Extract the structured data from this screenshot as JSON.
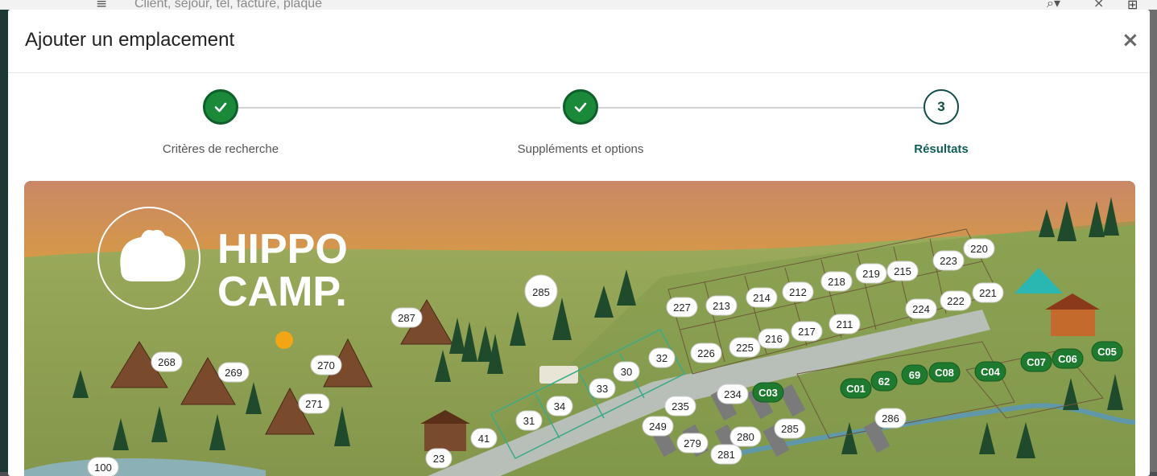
{
  "background": {
    "search_placeholder": "Client, séjour, tél, facture, plaque"
  },
  "modal": {
    "title": "Ajouter un emplacement",
    "close_glyph": "×"
  },
  "stepper": {
    "steps": [
      {
        "label": "Critères de recherche",
        "state": "done"
      },
      {
        "label": "Suppléments et options",
        "state": "done"
      },
      {
        "label": "Résultats",
        "state": "active",
        "number": "3"
      }
    ]
  },
  "map": {
    "brand_line1": "HIPPO",
    "brand_line2": "CAMP.",
    "pitches_white": [
      "285",
      "287",
      "268",
      "269",
      "270",
      "271",
      "100",
      "23",
      "41",
      "31",
      "34",
      "33",
      "30",
      "32",
      "227",
      "213",
      "214",
      "212",
      "218",
      "219",
      "215",
      "223",
      "220",
      "226",
      "225",
      "216",
      "217",
      "211",
      "224",
      "222",
      "221",
      "235",
      "234",
      "249",
      "279",
      "280",
      "285",
      "281",
      "286"
    ],
    "pitches_green": [
      "C03",
      "C01",
      "62",
      "69",
      "C08",
      "C04",
      "C07",
      "C06",
      "C05"
    ]
  },
  "colors": {
    "accent_green": "#1a8a3a",
    "active_teal": "#0f5f57",
    "pitch_green": "#1e7a2e"
  }
}
